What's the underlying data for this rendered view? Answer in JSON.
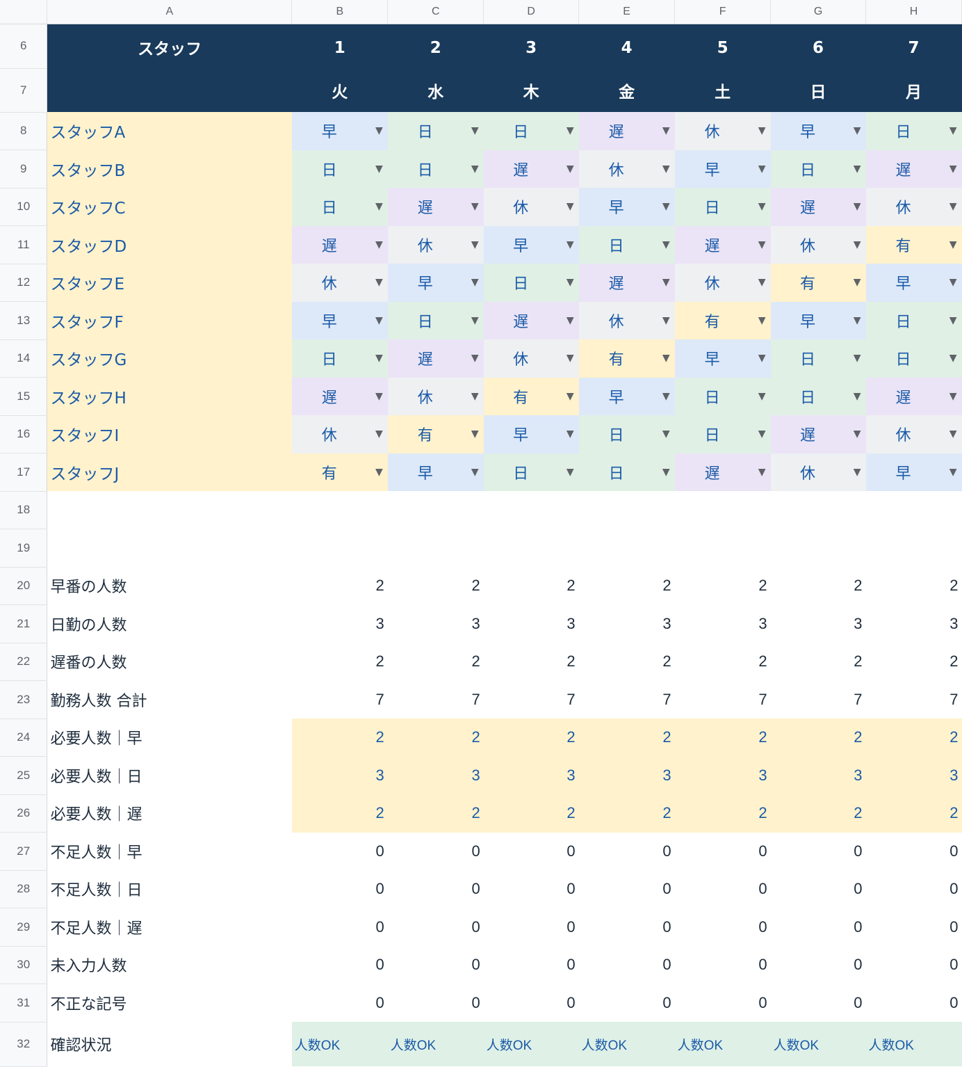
{
  "columns": [
    "A",
    "B",
    "C",
    "D",
    "E",
    "F",
    "G",
    "H"
  ],
  "header": {
    "staff_label": "スタッフ",
    "days": [
      "1",
      "2",
      "3",
      "4",
      "5",
      "6",
      "7"
    ],
    "weekdays": [
      "火",
      "水",
      "木",
      "金",
      "土",
      "日",
      "月"
    ]
  },
  "row_numbers": [
    "6",
    "7",
    "8",
    "9",
    "10",
    "11",
    "12",
    "13",
    "14",
    "15",
    "16",
    "17",
    "18",
    "19",
    "20",
    "21",
    "22",
    "23",
    "24",
    "25",
    "26",
    "27",
    "28",
    "29",
    "30",
    "31",
    "32"
  ],
  "staff": [
    {
      "name": "スタッフA",
      "shifts": [
        "早",
        "日",
        "日",
        "遅",
        "休",
        "早",
        "日"
      ]
    },
    {
      "name": "スタッフB",
      "shifts": [
        "日",
        "日",
        "遅",
        "休",
        "早",
        "日",
        "遅"
      ]
    },
    {
      "name": "スタッフC",
      "shifts": [
        "日",
        "遅",
        "休",
        "早",
        "日",
        "遅",
        "休"
      ]
    },
    {
      "name": "スタッフD",
      "shifts": [
        "遅",
        "休",
        "早",
        "日",
        "遅",
        "休",
        "有"
      ]
    },
    {
      "name": "スタッフE",
      "shifts": [
        "休",
        "早",
        "日",
        "遅",
        "休",
        "有",
        "早"
      ]
    },
    {
      "name": "スタッフF",
      "shifts": [
        "早",
        "日",
        "遅",
        "休",
        "有",
        "早",
        "日"
      ]
    },
    {
      "name": "スタッフG",
      "shifts": [
        "日",
        "遅",
        "休",
        "有",
        "早",
        "日",
        "日"
      ]
    },
    {
      "name": "スタッフH",
      "shifts": [
        "遅",
        "休",
        "有",
        "早",
        "日",
        "日",
        "遅"
      ]
    },
    {
      "name": "スタッフI",
      "shifts": [
        "休",
        "有",
        "早",
        "日",
        "日",
        "遅",
        "休"
      ]
    },
    {
      "name": "スタッフJ",
      "shifts": [
        "有",
        "早",
        "日",
        "日",
        "遅",
        "休",
        "早"
      ]
    }
  ],
  "shift_colors": {
    "早": "#dde9f9",
    "日": "#e0f0e5",
    "遅": "#ebe4f6",
    "休": "#eef0f2",
    "有": "#fff2cc"
  },
  "dropdown_icon": "triangle-down-icon",
  "summary": [
    {
      "label": "早番の人数",
      "values": [
        "2",
        "2",
        "2",
        "2",
        "2",
        "2",
        "2"
      ],
      "kind": "count"
    },
    {
      "label": "日勤の人数",
      "values": [
        "3",
        "3",
        "3",
        "3",
        "3",
        "3",
        "3"
      ],
      "kind": "count"
    },
    {
      "label": "遅番の人数",
      "values": [
        "2",
        "2",
        "2",
        "2",
        "2",
        "2",
        "2"
      ],
      "kind": "count"
    },
    {
      "label": "勤務人数 合計",
      "values": [
        "7",
        "7",
        "7",
        "7",
        "7",
        "7",
        "7"
      ],
      "kind": "count"
    },
    {
      "label": "必要人数｜早",
      "values": [
        "2",
        "2",
        "2",
        "2",
        "2",
        "2",
        "2"
      ],
      "kind": "required"
    },
    {
      "label": "必要人数｜日",
      "values": [
        "3",
        "3",
        "3",
        "3",
        "3",
        "3",
        "3"
      ],
      "kind": "required"
    },
    {
      "label": "必要人数｜遅",
      "values": [
        "2",
        "2",
        "2",
        "2",
        "2",
        "2",
        "2"
      ],
      "kind": "required"
    },
    {
      "label": "不足人数｜早",
      "values": [
        "0",
        "0",
        "0",
        "0",
        "0",
        "0",
        "0"
      ],
      "kind": "count"
    },
    {
      "label": "不足人数｜日",
      "values": [
        "0",
        "0",
        "0",
        "0",
        "0",
        "0",
        "0"
      ],
      "kind": "count"
    },
    {
      "label": "不足人数｜遅",
      "values": [
        "0",
        "0",
        "0",
        "0",
        "0",
        "0",
        "0"
      ],
      "kind": "count"
    },
    {
      "label": "未入力人数",
      "values": [
        "0",
        "0",
        "0",
        "0",
        "0",
        "0",
        "0"
      ],
      "kind": "count"
    },
    {
      "label": "不正な記号",
      "values": [
        "0",
        "0",
        "0",
        "0",
        "0",
        "0",
        "0"
      ],
      "kind": "count"
    }
  ],
  "status": {
    "label": "確認状況",
    "values": [
      "人数OK",
      "人数OK",
      "人数OK",
      "人数OK",
      "人数OK",
      "人数OK",
      "人数OK"
    ]
  }
}
